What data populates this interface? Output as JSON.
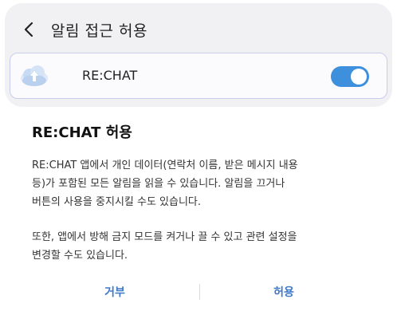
{
  "header": {
    "title": "알림 접근 허용",
    "back_icon": "chevron-left-icon"
  },
  "app_row": {
    "icon": "cloud-upload-icon",
    "name": "RE:CHAT",
    "toggle_on": true,
    "accent_color": "#3e8fdc"
  },
  "dialog": {
    "title": "RE:CHAT 허용",
    "body_lines_1": [
      "RE:CHAT 앱에서 개인 데이터(연락처 이름, 받은 메시지 내용",
      "등)가 포함된 모든 알림을 읽을 수 있습니다. 알림을 끄거나",
      "버튼의 사용을 중지시킬 수도 있습니다."
    ],
    "body_lines_2": [
      "또한, 앱에서 방해 금지 모드를 켜거나 끌 수 있고 관련 설정을",
      "변경할 수도 있습니다."
    ],
    "deny_label": "거부",
    "allow_label": "허용"
  }
}
